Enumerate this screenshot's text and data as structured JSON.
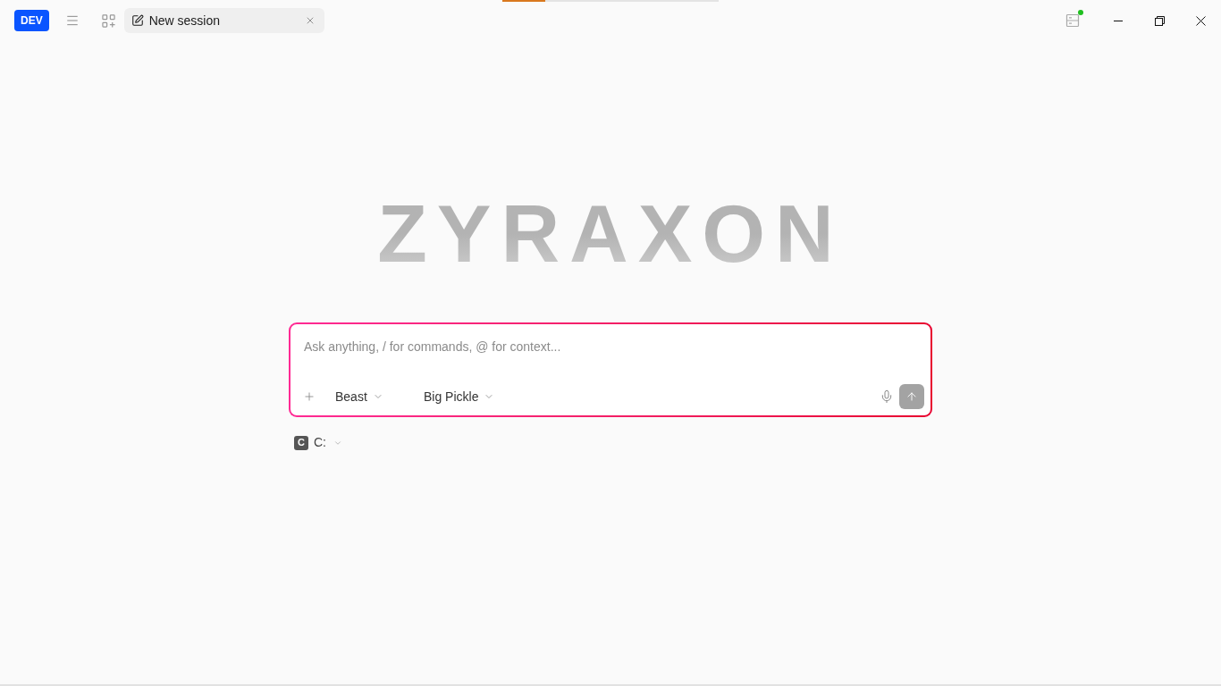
{
  "loading_bar": {
    "level": 0.2
  },
  "title_bar": {
    "badge": "DEV",
    "tabs": [
      {
        "title": "New session",
        "selected": true
      }
    ],
    "server_status": {
      "connected": true
    }
  },
  "logo": "ZYRAXON",
  "prompt": {
    "placeholder": "Ask anything, / for commands, @ for context...",
    "agent": "Beast",
    "model": "Big Pickle",
    "send_disabled": true
  },
  "directory": {
    "badge": "C",
    "label": "C:"
  }
}
